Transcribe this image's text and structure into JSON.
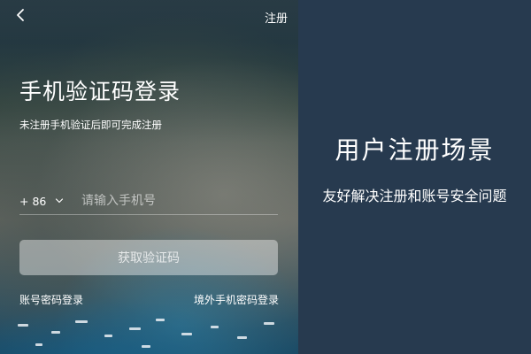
{
  "header": {
    "back_icon": "chevron-left-icon",
    "register_label": "注册"
  },
  "login": {
    "title": "手机验证码登录",
    "subtitle": "未注册手机验证后即可完成注册",
    "country_code": "+ 86",
    "country_code_icon": "chevron-down-icon",
    "phone_placeholder": "请输入手机号",
    "phone_value": "",
    "get_code_label": "获取验证码",
    "password_login_label": "账号密码登录",
    "overseas_login_label": "境外手机密码登录"
  },
  "caption": {
    "title": "用户注册场景",
    "subtitle": "友好解决注册和账号安全问题",
    "background_color": "#273a4f"
  }
}
